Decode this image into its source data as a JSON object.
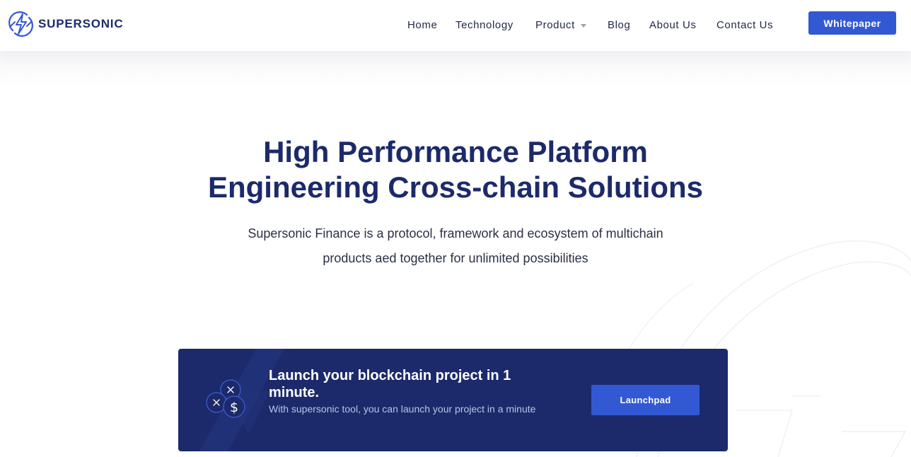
{
  "brand": {
    "name": "SUPERSONIC",
    "logo_icon": "lightning-circle-icon"
  },
  "nav": {
    "items": [
      {
        "label": "Home"
      },
      {
        "label": "Technology"
      },
      {
        "label": "Product",
        "has_dropdown": true,
        "dropdown_icon": "caret-down-icon"
      },
      {
        "label": "Blog"
      },
      {
        "label": "About Us"
      },
      {
        "label": "Contact Us"
      }
    ],
    "cta_label": "Whitepaper"
  },
  "hero": {
    "title_line1": "High Performance Platform",
    "title_line2": "Engineering Cross-chain Solutions",
    "subtitle_line1": "Supersonic Finance is a protocol, framework and ecosystem of multichain",
    "subtitle_line2": "products aed together for unlimited possibilities"
  },
  "banner": {
    "icon": "coins-icon",
    "title": "Launch your blockchain project in 1 minute.",
    "description": "With supersonic tool, you can launch your project in a minute",
    "button_label": "Launchpad"
  },
  "colors": {
    "primary": "#3358d4",
    "navy": "#1c2a6b",
    "text": "#1f2846",
    "muted_text": "#b9c3e8"
  }
}
